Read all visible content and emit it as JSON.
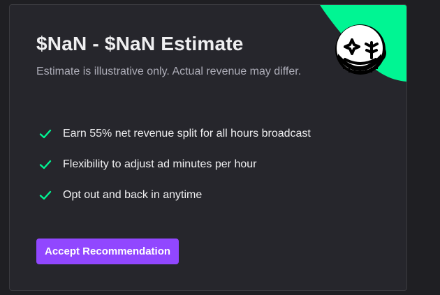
{
  "card": {
    "title": "$NaN - $NaN Estimate",
    "subtitle": "Estimate is illustrative only. Actual revenue may differ."
  },
  "benefits": [
    {
      "icon": "checkmark-icon",
      "text": "Earn 55% net revenue split for all hours broadcast"
    },
    {
      "icon": "checkmark-icon",
      "text": "Flexibility to adjust ad minutes per hour"
    },
    {
      "icon": "checkmark-icon",
      "text": "Opt out and back in anytime"
    }
  ],
  "actions": {
    "accept_label": "Accept Recommendation"
  },
  "colors": {
    "background": "#1f1f23",
    "card": "#26262c",
    "accent_green": "#00f593",
    "accent_purple": "#9147ff",
    "text_primary": "#efeff1",
    "text_secondary": "#adadb8"
  },
  "decoration": {
    "icon": "happy-coin-face-icon"
  }
}
